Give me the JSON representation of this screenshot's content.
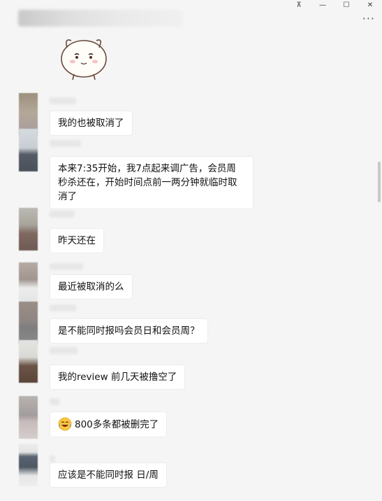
{
  "window": {
    "pin": "⊼",
    "minimize": "—",
    "maximize": "☐",
    "close": "✕"
  },
  "header": {
    "more": "···"
  },
  "messages": [
    {
      "text": "我的也被取消了"
    },
    {
      "text": "本来7:35开始，我7点起来调广告，会员周秒杀还在，开始时间点前一两分钟就临时取消了"
    },
    {
      "text": "昨天还在"
    },
    {
      "text": "最近被取消的么"
    },
    {
      "text": "是不能同时报吗会员日和会员周？"
    },
    {
      "text": "我的review 前几天被撸空了"
    },
    {
      "text": "800多条都被删完了",
      "emoji": "crying-laughing"
    },
    {
      "text": "应该是不能同时报 日/周"
    }
  ]
}
